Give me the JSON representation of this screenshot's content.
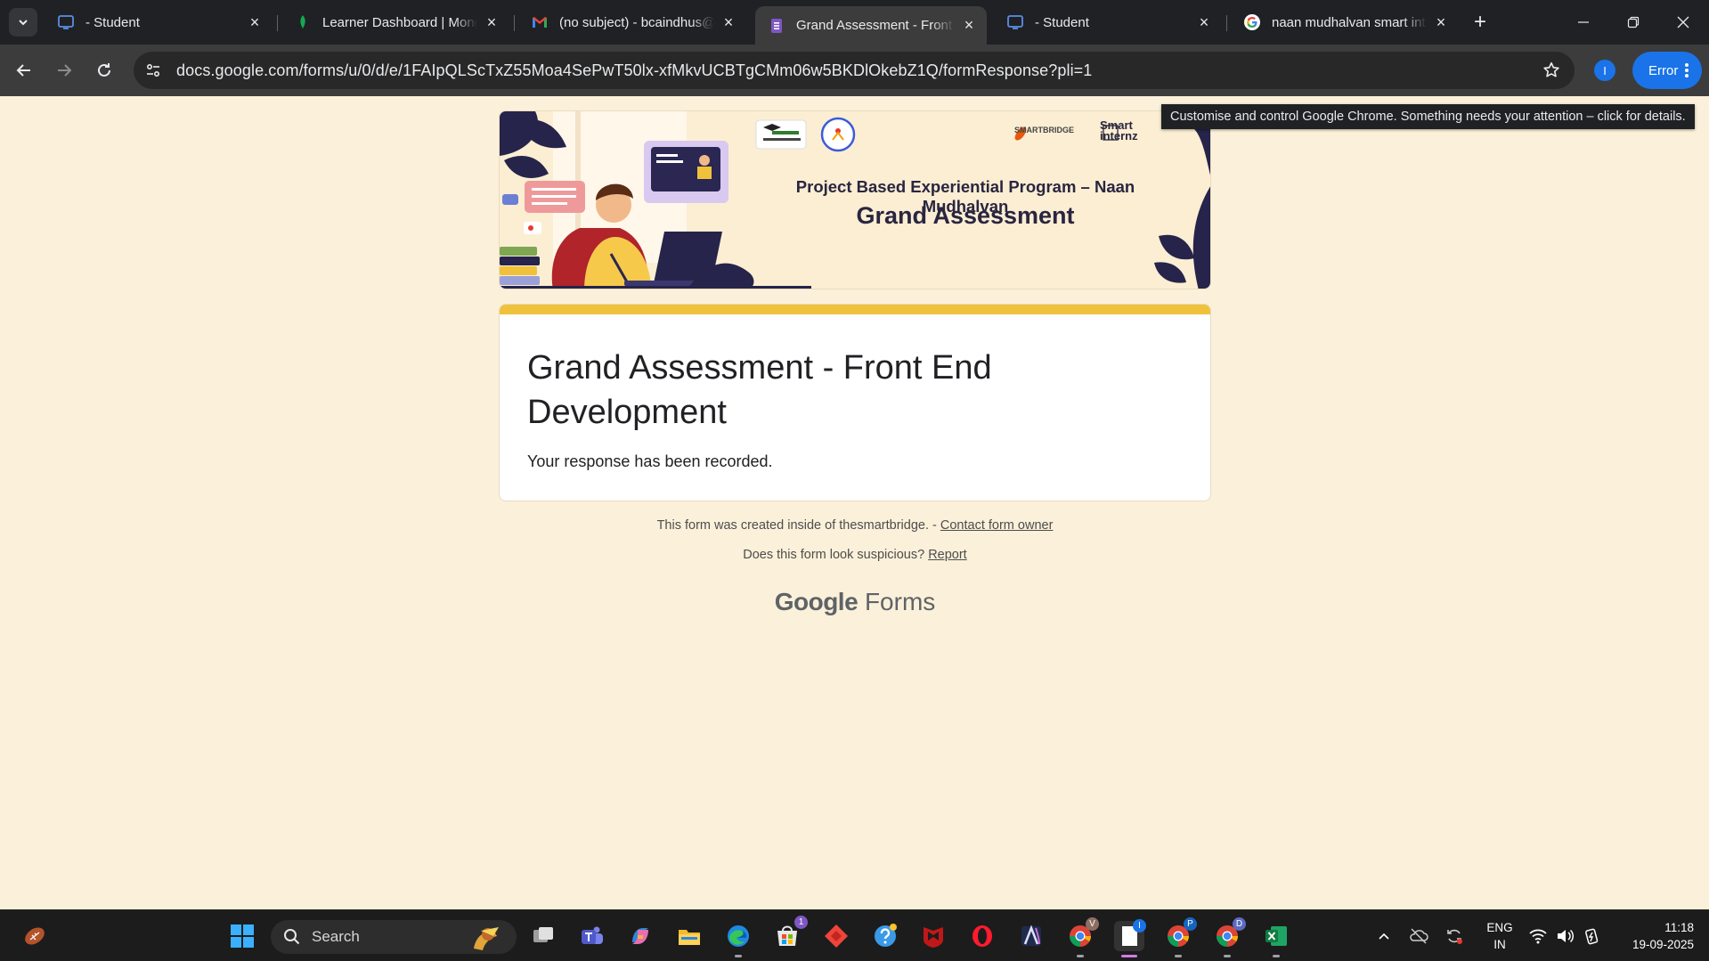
{
  "browser": {
    "tabs": [
      {
        "title": "- Student",
        "favicon": "monitor-icon",
        "active": false
      },
      {
        "title": "Learner Dashboard | MongoDB",
        "favicon": "leaf-icon",
        "active": false
      },
      {
        "title": "(no subject) - bcaindhus@gmail.com",
        "favicon": "gmail-icon",
        "active": false
      },
      {
        "title": "Grand Assessment - Front End Development",
        "favicon": "forms-icon",
        "active": true
      },
      {
        "title": "- Student",
        "favicon": "monitor-icon",
        "active": false
      },
      {
        "title": "naan mudhalvan smart internz",
        "favicon": "google-icon",
        "active": false
      }
    ],
    "url": "docs.google.com/forms/u/0/d/e/1FAIpQLScTxZ55Moa4SePwT50lx-xfMkvUCBTgCMm06w5BKDlOkebZ1Q/formResponse?pli=1",
    "profile_initial": "I",
    "error_label": "Error",
    "tooltip": "Customise and control Google Chrome. Something needs your attention – click for details."
  },
  "banner": {
    "subtitle": "Project Based Experiential Program – Naan Mudhalvan",
    "title": "Grand Assessment",
    "logo_smartbridge": "SMARTBRIDGE",
    "logo_smartinternz_1": "Smart",
    "logo_smartinternz_2": "internz"
  },
  "form": {
    "title": "Grand Assessment - Front End Development",
    "message": "Your response has been recorded.",
    "accent_color": "#f0c23b",
    "page_background": "#fbf0d9"
  },
  "footer": {
    "created_text": "This form was created inside of thesmartbridge. - ",
    "contact_link": "Contact form owner",
    "suspicious_text": "Does this form look suspicious? ",
    "report_link": "Report",
    "brand_google": "Google",
    "brand_forms": "Forms"
  },
  "taskbar": {
    "search_label": "Search",
    "lang_line1": "ENG",
    "lang_line2": "IN",
    "time": "11:18",
    "date": "19-09-2025",
    "store_badge": "1",
    "chrome_badge_v": "V",
    "chrome_badge_i": "I",
    "chrome_badge_p": "P",
    "chrome_badge_d": "D"
  }
}
